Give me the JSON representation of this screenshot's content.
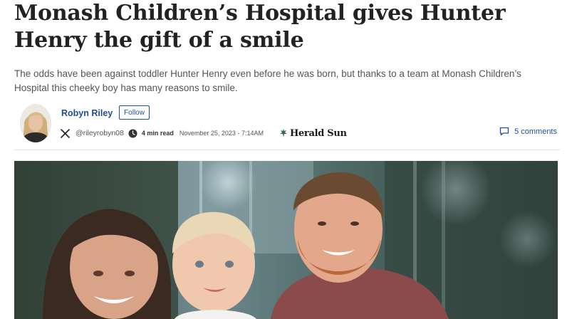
{
  "article": {
    "headline": "Monash Children’s Hospital gives Hunter Henry the gift of a smile",
    "standfirst": "The odds have been against toddler Hunter Henry even before he was born, but thanks to a team at Monash Children’s Hospital this cheeky boy has many reasons to smile."
  },
  "byline": {
    "author": "Robyn Riley",
    "follow_label": "Follow",
    "handle": "@rileyrobyn08",
    "read_time": "4 min read",
    "date": "November 25, 2023 - 7:14AM",
    "brand": "Herald Sun",
    "comments_label": "5 comments"
  },
  "icons": {
    "social": "x-icon",
    "time": "clock-icon",
    "comments": "comment-icon"
  },
  "colors": {
    "link": "#1f4f96",
    "headline": "#222222",
    "standfirst": "#555555"
  }
}
